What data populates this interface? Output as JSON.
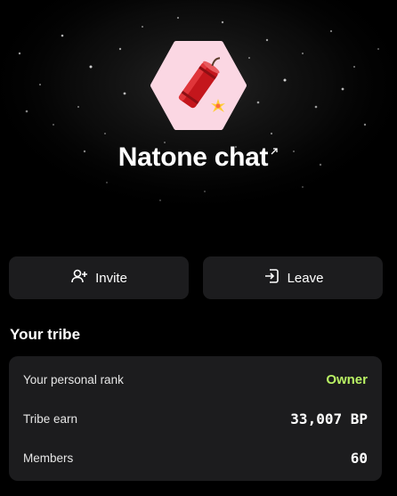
{
  "chat": {
    "title": "Natone chat",
    "logo_icon": "firecracker-icon",
    "logo_bg": "#fbd7e3"
  },
  "actions": {
    "invite_label": "Invite",
    "leave_label": "Leave"
  },
  "tribe": {
    "section_title": "Your tribe",
    "rank_label": "Your personal rank",
    "rank_value": "Owner",
    "earn_label": "Tribe earn",
    "earn_value": "33,007 BP",
    "members_label": "Members",
    "members_value": "60"
  },
  "colors": {
    "background": "#000000",
    "card": "#1c1c1e",
    "accent_owner": "#b9f164"
  }
}
